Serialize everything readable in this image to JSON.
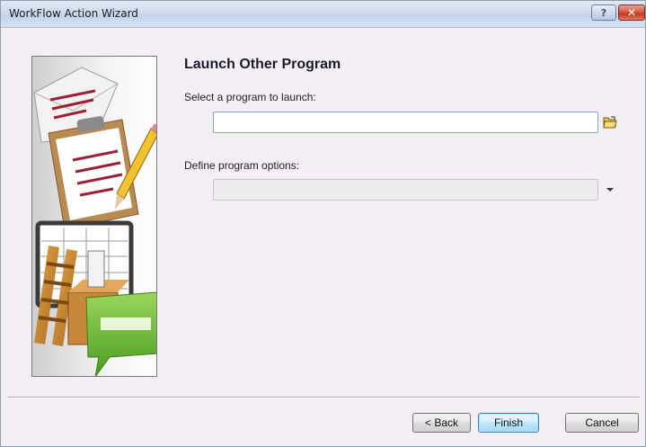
{
  "window": {
    "title": "WorkFlow Action Wizard",
    "help_glyph": "?",
    "close_glyph": "✕"
  },
  "page": {
    "heading": "Launch Other Program"
  },
  "program": {
    "label": "Select a program to launch:",
    "value": "",
    "browse_icon": "folder-open-icon"
  },
  "options": {
    "label": "Define program options:",
    "value": "",
    "enabled": false,
    "dropdown_icon": "dropdown-arrow-icon"
  },
  "buttons": {
    "back": "< Back",
    "finish": "Finish",
    "cancel": "Cancel"
  },
  "colors": {
    "window_bg": "#f3eff4",
    "accent": "#3c7fb1"
  }
}
